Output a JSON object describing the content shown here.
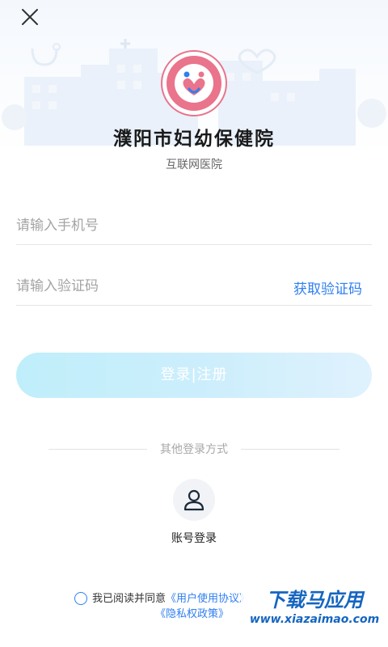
{
  "header": {
    "hospital_name": "濮阳市妇幼保健院",
    "hospital_subtitle": "互联网医院",
    "logo_ring_text": "濮阳市妇幼保健院"
  },
  "form": {
    "phone_placeholder": "请输入手机号",
    "code_placeholder": "请输入验证码",
    "get_code_label": "获取验证码",
    "submit_label": "登录|注册"
  },
  "other_login": {
    "divider_text": "其他登录方式",
    "account_login_label": "账号登录"
  },
  "agreement": {
    "prefix": "我已阅读并同意",
    "user_agreement": "《用户使用协议》",
    "privacy_policy": "《隐私权政策》"
  },
  "watermark": {
    "title": "下载马应用",
    "url": "www.xiazaimao.com"
  },
  "colors": {
    "accent": "#2f7ff0",
    "button_gradient_start": "#bfeefa",
    "button_gradient_end": "#dff2fd",
    "logo_pink": "#e9748c"
  },
  "icons": {
    "close": "close-icon",
    "account": "person-icon",
    "logo": "hospital-logo"
  }
}
